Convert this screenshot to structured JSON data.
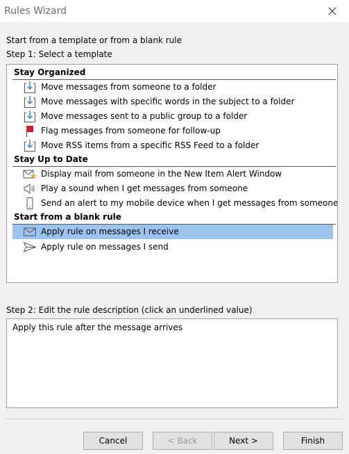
{
  "window": {
    "title": "Rules Wizard"
  },
  "intro_label": "Start from a template or from a blank rule",
  "step1_label": "Step 1: Select a template",
  "groups": [
    {
      "label": "Stay Organized"
    },
    {
      "label": "Stay Up to Date"
    },
    {
      "label": "Start from a blank rule"
    }
  ],
  "templates": [
    {
      "label": "Move messages from someone to a folder",
      "icon": "move-to-folder-icon"
    },
    {
      "label": "Move messages with specific words in the subject to a folder",
      "icon": "move-to-folder-icon"
    },
    {
      "label": "Move messages sent to a public group to a folder",
      "icon": "move-to-folder-icon"
    },
    {
      "label": "Flag messages from someone for follow-up",
      "icon": "flag-icon"
    },
    {
      "label": "Move RSS items from a specific RSS Feed to a folder",
      "icon": "move-to-folder-icon"
    },
    {
      "label": "Display mail from someone in the New Item Alert Window",
      "icon": "new-item-alert-icon"
    },
    {
      "label": "Play a sound when I get messages from someone",
      "icon": "speaker-icon"
    },
    {
      "label": "Send an alert to my mobile device when I get messages from someone",
      "icon": "mobile-device-icon"
    },
    {
      "label": "Apply rule on messages I receive",
      "icon": "envelope-icon",
      "selected": true
    },
    {
      "label": "Apply rule on messages I send",
      "icon": "send-arrow-icon"
    }
  ],
  "step2_label": "Step 2: Edit the rule description (click an underlined value)",
  "rule_description": "Apply this rule after the message arrives",
  "buttons": {
    "cancel": "Cancel",
    "back": "< Back",
    "next": "Next >",
    "finish": "Finish"
  },
  "colors": {
    "selection": "#9bc5ee",
    "folder_arrow": "#2f86d6",
    "flag": "#e81123",
    "alert_star": "#f5a623"
  }
}
